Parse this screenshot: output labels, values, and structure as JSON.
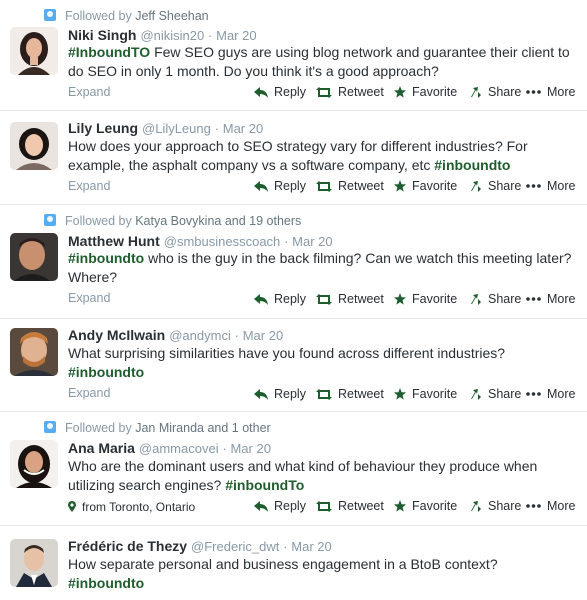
{
  "actions": {
    "reply": "Reply",
    "retweet": "Retweet",
    "favorite": "Favorite",
    "share": "Share",
    "more": "More"
  },
  "common": {
    "expand": "Expand",
    "dot": "·",
    "and": "and"
  },
  "colors": {
    "hashtag": "#1f5d2e",
    "muted": "#8899a6",
    "accent": "#1f5d2e"
  },
  "tweets": [
    {
      "context": {
        "prefix": "Followed by",
        "actor": "Jeff Sheehan",
        "extra": ""
      },
      "name": "Niki Singh",
      "handle": "@nikisin20",
      "time": "Mar 20",
      "hashtag_lead": "#InboundTO",
      "text": " Few SEO guys are using blog network and guarantee their client to do SEO in only 1 month. Do you think it's a good approach?",
      "hashtag_tail": ""
    },
    {
      "name": "Lily Leung",
      "handle": "@LilyLeung",
      "time": "Mar 20",
      "hashtag_lead": "",
      "text": "How does your approach to SEO strategy vary for different industries? For example, the asphalt company vs a software company, etc ",
      "hashtag_tail": "#inboundto"
    },
    {
      "context": {
        "prefix": "Followed by",
        "actor": "Katya Bovykina",
        "extra": "and 19 others"
      },
      "name": "Matthew Hunt",
      "handle": "@smbusinesscoach",
      "time": "Mar 20",
      "hashtag_lead": "#inboundto",
      "text": " who is the guy in the back filming? Can we watch this meeting later? Where?",
      "hashtag_tail": ""
    },
    {
      "name": "Andy McIlwain",
      "handle": "@andymci",
      "time": "Mar 20",
      "hashtag_lead": "",
      "text": "What surprising similarities have you found across different industries?",
      "hashtag_tail": "#inboundto"
    },
    {
      "context": {
        "prefix": "Followed by",
        "actor": "Jan Miranda",
        "extra": "and 1 other"
      },
      "name": "Ana Maria",
      "handle": "@ammacovei",
      "time": "Mar 20",
      "hashtag_lead": "",
      "text": "Who are the dominant users and what kind of behaviour they produce when utilizing search engines? ",
      "hashtag_tail": "#inboundTo",
      "location": "from Toronto, Ontario"
    },
    {
      "name": "Frédéric de Thezy",
      "handle": "@Frederic_dwt",
      "time": "Mar 20",
      "hashtag_lead": "",
      "text": "How separate personal and business engagement in a BtoB context?",
      "hashtag_tail": "#inboundto"
    }
  ]
}
